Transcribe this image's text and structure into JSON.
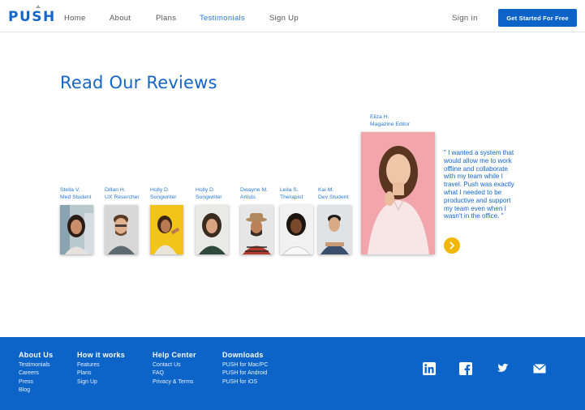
{
  "header": {
    "logo": "PUSH",
    "nav": [
      "Home",
      "About",
      "Plans",
      "Testimonials",
      "Sign Up"
    ],
    "active_nav": "Testimonials",
    "signin": "Sign in",
    "cta": "Get Started For Free"
  },
  "main": {
    "title": "Read Our Reviews",
    "people": [
      {
        "name": "Stella V.",
        "role": "Med Student"
      },
      {
        "name": "Dillan H.",
        "role": "UX Resercher"
      },
      {
        "name": "Holly D.",
        "role": "Songwriter"
      },
      {
        "name": "Holly D.",
        "role": "Songwriter"
      },
      {
        "name": "Dwayne M.",
        "role": "Artists"
      },
      {
        "name": "Leila S.",
        "role": "Therapist"
      },
      {
        "name": "Kai M.",
        "role": "Dev Student"
      }
    ],
    "featured": {
      "name": "Eliza H.",
      "role": "Magazine Editor",
      "quote_lines": [
        "\" I wanted a system that",
        "would allow me to work",
        "offline and collaborate",
        "with my team while I",
        "travel. Push was exactly",
        "what I needed to be",
        "productive and support",
        "my team even when I",
        "wasn't in the office. \""
      ]
    },
    "next_icon": "chevron-right-icon"
  },
  "footer": {
    "columns": [
      {
        "title": "About Us",
        "links": [
          "Testimonials",
          "Careers",
          "Press",
          "Blog"
        ]
      },
      {
        "title": "How it works",
        "links": [
          "Features",
          "Plans",
          "Sign Up"
        ]
      },
      {
        "title": "Help Center",
        "links": [
          "Contact Us",
          "FAQ",
          "Privacy & Terms"
        ]
      },
      {
        "title": "Downloads",
        "links": [
          "PUSH for Mac/PC",
          "PUSH for Android",
          "PUSH for iOS"
        ]
      }
    ],
    "social_icons": [
      "linkedin-icon",
      "facebook-icon",
      "twitter-icon",
      "mail-icon"
    ]
  },
  "colors": {
    "brand_blue": "#0c63c8",
    "heading_blue": "#1466c9",
    "accent_yellow": "#f2b705"
  }
}
